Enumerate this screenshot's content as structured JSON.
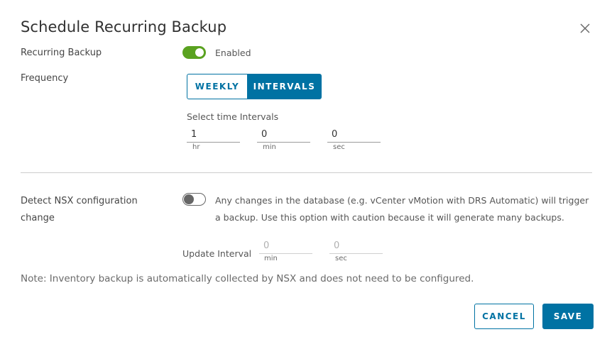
{
  "dialog": {
    "title": "Schedule Recurring Backup",
    "close_icon": "close-icon"
  },
  "recurring_backup": {
    "label": "Recurring Backup",
    "toggle_on": true,
    "status_text": "Enabled"
  },
  "frequency": {
    "label": "Frequency",
    "options": [
      "WEEKLY",
      "INTERVALS"
    ],
    "selected": "INTERVALS",
    "intervals_label": "Select time Intervals",
    "fields": [
      {
        "value": "1",
        "unit": "hr"
      },
      {
        "value": "0",
        "unit": "min"
      },
      {
        "value": "0",
        "unit": "sec"
      }
    ]
  },
  "detect_change": {
    "label_line1": "Detect NSX configuration",
    "label_line2": "change",
    "toggle_on": false,
    "description": "Any changes in the database (e.g. vCenter vMotion with DRS Automatic) will trigger a backup. Use this option with caution because it will generate many backups.",
    "update_interval_label": "Update Interval",
    "update_fields": [
      {
        "placeholder": "0",
        "unit": "min"
      },
      {
        "placeholder": "0",
        "unit": "sec"
      }
    ]
  },
  "note": "Note: Inventory backup is automatically collected by NSX and does not need to be configured.",
  "footer": {
    "cancel_label": "CANCEL",
    "save_label": "SAVE"
  },
  "colors": {
    "accent": "#0072a3",
    "toggle_on": "#5aa220"
  }
}
